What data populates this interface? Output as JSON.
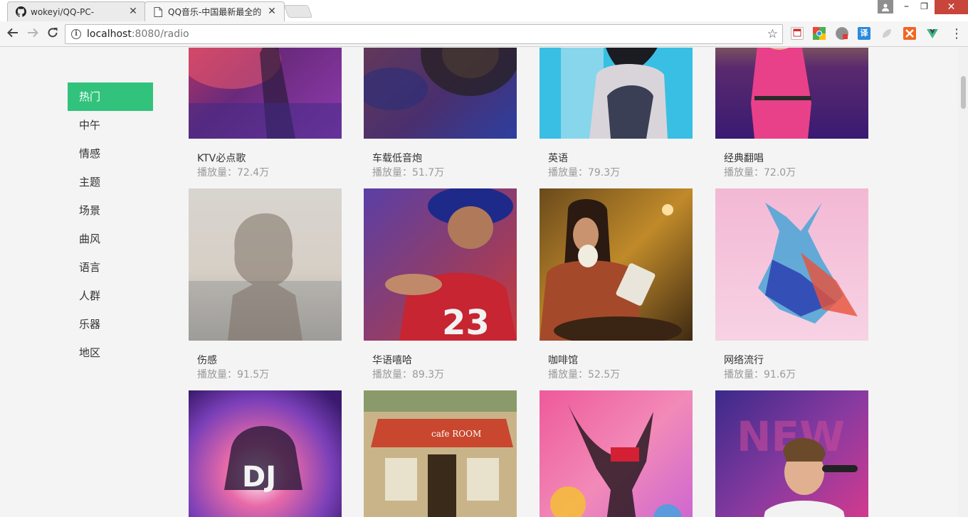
{
  "browser": {
    "tabs": [
      {
        "title": "wokeyi/QQ-PC-",
        "icon": "github-icon",
        "active": false
      },
      {
        "title": "QQ音乐-中国最新最全的",
        "icon": "page-icon",
        "active": true
      }
    ],
    "address": {
      "host": "localhost",
      "path": ":8080/radio"
    },
    "extensions": [
      "notes-ext-icon",
      "chrome-ext-icon",
      "adblock-ext-icon",
      "translate-ext-icon",
      "leaf-ext-icon",
      "puzzle-ext-icon",
      "vue-devtools-icon"
    ],
    "window_controls": {
      "minimize": "–",
      "restore": "❐",
      "close": "✕"
    }
  },
  "sidebar": {
    "categories": [
      "热门",
      "中午",
      "情感",
      "主题",
      "场景",
      "曲风",
      "语言",
      "人群",
      "乐器",
      "地区"
    ],
    "active_index": 0
  },
  "radios": [
    {
      "name": "KTV必点歌",
      "plays": "播放量：72.4万"
    },
    {
      "name": "车载低音炮",
      "plays": "播放量：51.7万"
    },
    {
      "name": "英语",
      "plays": "播放量：79.3万"
    },
    {
      "name": "经典翻唱",
      "plays": "播放量：72.0万"
    },
    {
      "name": "伤感",
      "plays": "播放量：91.5万"
    },
    {
      "name": "华语嘻哈",
      "plays": "播放量：89.3万"
    },
    {
      "name": "咖啡馆",
      "plays": "播放量：52.5万"
    },
    {
      "name": "网络流行",
      "plays": "播放量：91.6万"
    },
    {
      "name": "",
      "plays": ""
    },
    {
      "name": "",
      "plays": ""
    },
    {
      "name": "",
      "plays": ""
    },
    {
      "name": "",
      "plays": ""
    }
  ],
  "cover_text": {
    "dj": "DJ",
    "new": "NEW",
    "cafe_sign": "cafe ROOM"
  },
  "colors": {
    "accent": "#31c27c",
    "page_bg": "#f4f4f4",
    "muted_text": "#999999"
  }
}
